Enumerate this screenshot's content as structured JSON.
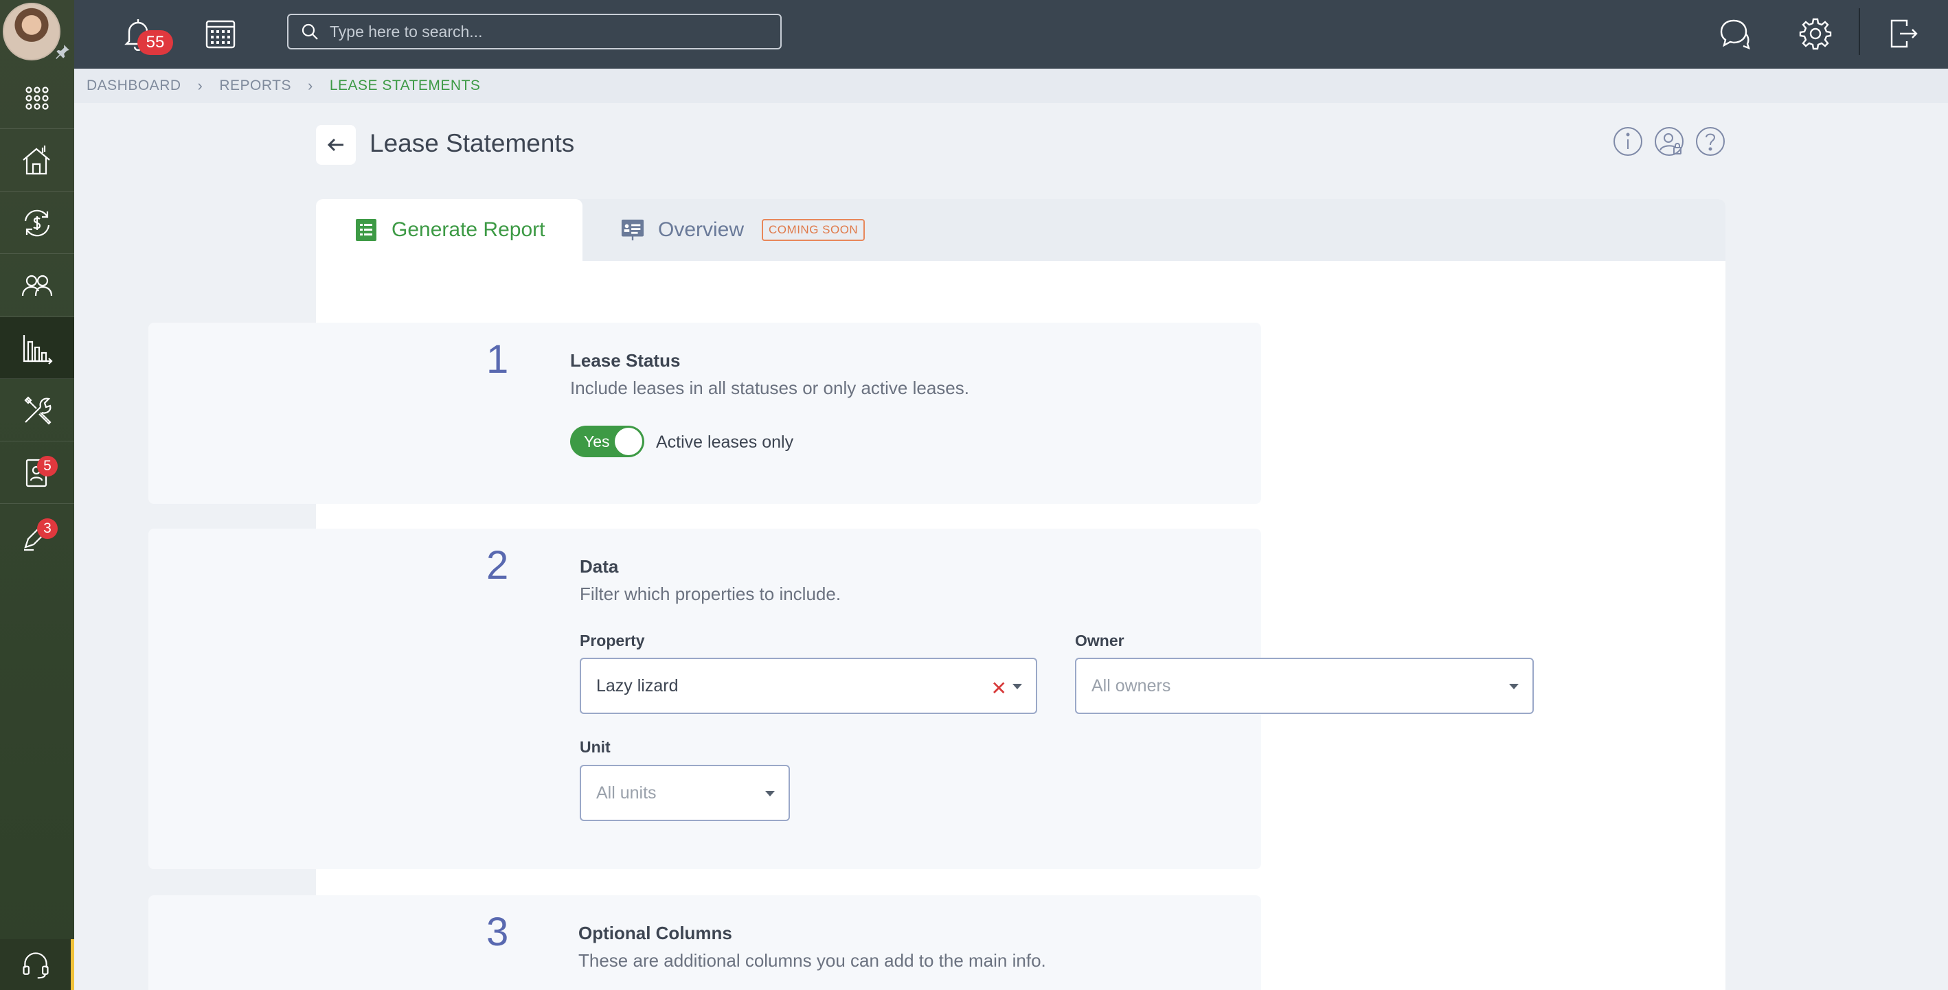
{
  "topbar": {
    "notification_count": "55",
    "search_placeholder": "Type here to search..."
  },
  "sidebar": {
    "items": [
      {
        "name": "apps",
        "icon": "grid-icon"
      },
      {
        "name": "properties",
        "icon": "house-icon"
      },
      {
        "name": "accounting",
        "icon": "dollar-cycle-icon"
      },
      {
        "name": "people",
        "icon": "users-icon"
      },
      {
        "name": "reports",
        "icon": "bar-chart-icon",
        "active": true
      },
      {
        "name": "maintenance",
        "icon": "tools-icon"
      },
      {
        "name": "applications",
        "icon": "contact-card-icon",
        "badge": "5"
      },
      {
        "name": "signatures",
        "icon": "pen-icon",
        "badge": "3"
      }
    ]
  },
  "breadcrumb": {
    "items": [
      "DASHBOARD",
      "REPORTS",
      "LEASE STATEMENTS"
    ]
  },
  "page": {
    "title": "Lease Statements"
  },
  "tabs": {
    "generate": "Generate Report",
    "overview": "Overview",
    "coming_soon": "COMING SOON"
  },
  "steps": {
    "one": {
      "number": "1",
      "title": "Lease Status",
      "description": "Include leases in all statuses or only active leases.",
      "toggle_text": "Yes",
      "toggle_label": "Active leases only"
    },
    "two": {
      "number": "2",
      "title": "Data",
      "description": "Filter which properties to include.",
      "property_label": "Property",
      "property_value": "Lazy lizard",
      "owner_label": "Owner",
      "owner_placeholder": "All owners",
      "unit_label": "Unit",
      "unit_placeholder": "All units"
    },
    "three": {
      "number": "3",
      "title": "Optional Columns",
      "description": "These are additional columns you can add to the main info."
    }
  },
  "colors": {
    "accent_green": "#3d9a45",
    "step_number": "#5969b0",
    "badge_red": "#e0383e",
    "topbar": "#3a4550",
    "sidebar": "#35452f"
  }
}
